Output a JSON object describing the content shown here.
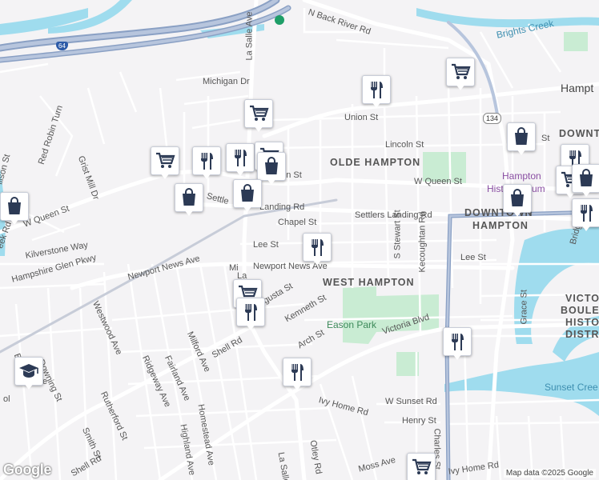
{
  "map": {
    "attribution": "Map data ©2025 Google",
    "logo": "Google",
    "neighborhoods": [
      "OLDE HAMPTON",
      "WEST HAMPTON",
      "DOWNTOWN HAMPTON",
      "DOWNT",
      "VICTO BOULEVE HISTO DISTR"
    ],
    "hood_olde": "OLDE HAMPTON",
    "hood_west": "WEST HAMPTON",
    "hood_downtown_1": "DOWNTOWN",
    "hood_downtown_2": "HAMPTON",
    "hood_downt": "DOWNT",
    "hood_victo_1": "VICTO",
    "hood_victo_2": "BOULEVE",
    "hood_victo_3": "HISTO",
    "hood_victo_4": "DISTR",
    "city_label": "Hampt",
    "park_eason": "Eason Park",
    "water_brights": "Brights Creek",
    "water_sunset": "Sunset Cree",
    "poi_history_1": "Hampton",
    "poi_history_2": "History",
    "poi_history_3": "um",
    "shield_134": "134",
    "shield_64": "64",
    "streets": {
      "n_back_river": "N Back River Rd",
      "la_salle_top": "La Salle Ave",
      "la_salle_bottom": "La Salle Ave",
      "michigan": "Michigan Dr",
      "union": "Union St",
      "lincoln": "Lincoln St",
      "w_queen_left": "W Queen St",
      "w_queen_mid": "een St",
      "w_queen_right": "W Queen St",
      "settlers_left": "Settle",
      "settlers_mid": "Landing Rd",
      "settlers_right": "Settlers Landing Rd",
      "chapel": "Chapel St",
      "lee_left": "Lee St",
      "lee_right": "Lee St",
      "newport_left": "Newport News Ave",
      "newport_right": "Newport News Ave",
      "augusta": "gusta St",
      "kemneth": "Kemneth St",
      "arch": "Arch St",
      "victoria": "Victoria Blvd",
      "kecoughtan": "Kecoughtan Rd",
      "s_stewart": "S Stewart St",
      "grace": "Grace St",
      "bridge": "Bridge",
      "charles": "Charles St",
      "w_sunset": "W Sunset Rd",
      "henry": "Henry St",
      "ivy_home_mid": "Ivy Home Rd",
      "ivy_home_bottom": "Ivy Home Rd",
      "otley": "Otley Rd",
      "moss": "Moss Ave",
      "shell_mid": "Shell Rd",
      "shell_bottom": "Shell Rd",
      "homestead": "Homestead Ave",
      "highland": "Highland Ave",
      "milford": "Milford Ave",
      "fairland": "Fairland Ave",
      "ridgeway": "Ridgeway Ave",
      "westwood": "Westwood Ave",
      "rutherford": "Rutherford St",
      "smith": "Smith St",
      "downing": "Downing St",
      "kilverstone": "Kilverstone Way",
      "hampshire": "Hampshire Glen Pkwy",
      "red_robin": "Red Robin Turn",
      "grist_mill": "Grist Mill Dr",
      "allison": "llison St",
      "creek": "eek Rd",
      "bea": "Bea",
      "ol": "ol",
      "te": "te",
      "mi": "Mi",
      "la": "La",
      "sty": "St"
    },
    "markers": [
      {
        "type": "shopping-cart",
        "icon": "shopping-cart-icon"
      },
      {
        "type": "restaurant",
        "icon": "fork-knife-icon"
      },
      {
        "type": "shopping-bag",
        "icon": "shopping-bag-icon"
      },
      {
        "type": "school",
        "icon": "graduation-cap-icon"
      }
    ]
  }
}
